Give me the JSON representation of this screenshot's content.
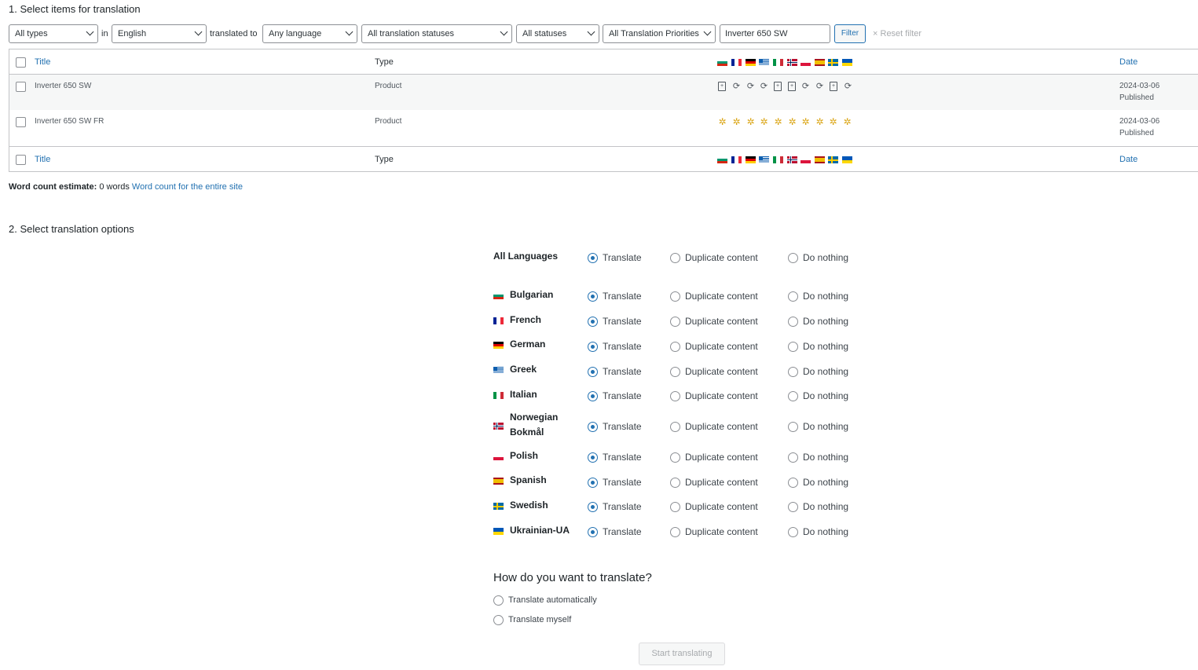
{
  "section1_title": "1. Select items for translation",
  "filters": {
    "type": "All types",
    "in_label": "in",
    "source_language": "English",
    "translated_to_label": "translated to",
    "target_language": "Any language",
    "translation_status": "All translation statuses",
    "status": "All statuses",
    "priority": "All Translation Priorities",
    "search_value": "Inverter 650 SW",
    "filter_button": "Filter",
    "reset_filter": "Reset filter"
  },
  "table": {
    "col_title": "Title",
    "col_type": "Type",
    "col_date": "Date",
    "rows": [
      {
        "title": "Inverter 650 SW",
        "type": "Product",
        "date": "2024-03-06",
        "status": "Published"
      },
      {
        "title": "Inverter 650 SW FR",
        "type": "Product",
        "date": "2024-03-06",
        "status": "Published"
      }
    ]
  },
  "word_count": {
    "label": "Word count estimate:",
    "value": "0 words",
    "link": "Word count for the entire site"
  },
  "section2_title": "2. Select translation options",
  "options": {
    "translate": "Translate",
    "duplicate": "Duplicate content",
    "nothing": "Do nothing",
    "all_languages": "All Languages",
    "languages": [
      "Bulgarian",
      "French",
      "German",
      "Greek",
      "Italian",
      "Norwegian Bokmål",
      "Polish",
      "Spanish",
      "Swedish",
      "Ukrainian-UA"
    ]
  },
  "how": {
    "title": "How do you want to translate?",
    "auto": "Translate automatically",
    "myself": "Translate myself",
    "start_button": "Start translating"
  },
  "colors": {
    "accent": "#2271b1",
    "star": "#dba617"
  }
}
